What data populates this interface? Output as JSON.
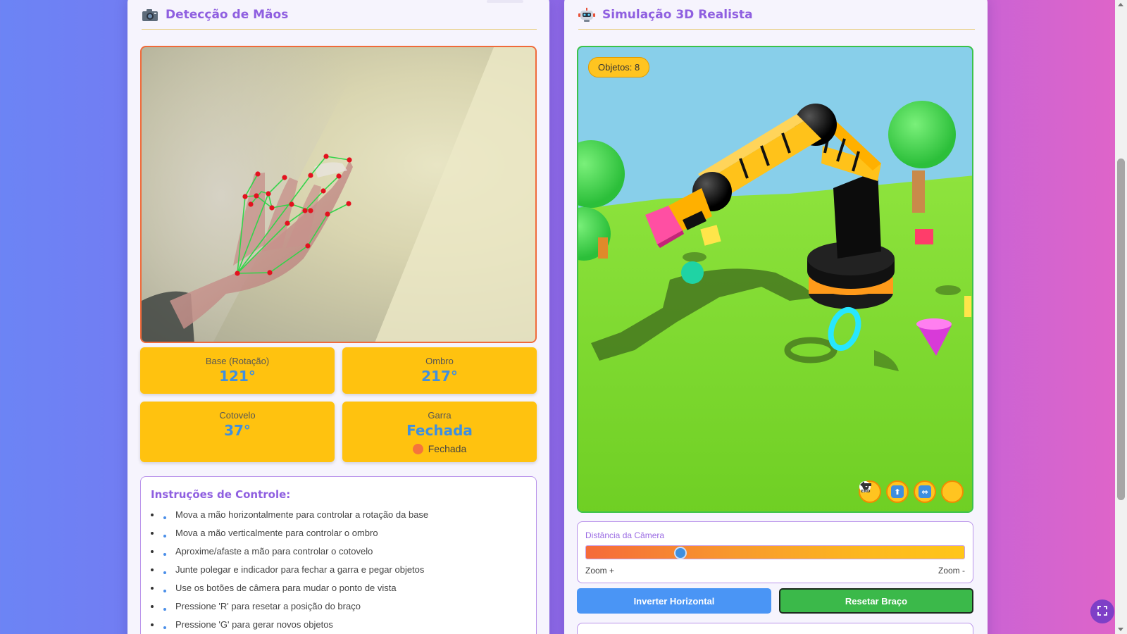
{
  "hand_panel": {
    "title": "Detecção de Mãos",
    "icon": "camera-icon"
  },
  "angles": {
    "base": {
      "label": "Base (Rotação)",
      "value": "121°"
    },
    "shoulder": {
      "label": "Ombro",
      "value": "217°"
    },
    "elbow": {
      "label": "Cotovelo",
      "value": "37°"
    },
    "grip": {
      "label": "Garra",
      "value": "Fechada",
      "state": "Fechada",
      "state_color": "#f5743c"
    }
  },
  "instructions": {
    "title": "Instruções de Controle:",
    "items": [
      "Mova a mão horizontalmente para controlar a rotação da base",
      "Mova a mão verticalmente para controlar o ombro",
      "Aproxime/afaste a mão para controlar o cotovelo",
      "Junte polegar e indicador para fechar a garra e pegar objetos",
      "Use os botões de câmera para mudar o ponto de vista",
      "Pressione 'R' para resetar a posição do braço",
      "Pressione 'G' para gerar novos objetos"
    ]
  },
  "sim_panel": {
    "title": "Simulação 3D Realista",
    "icon": "robot-icon",
    "objects_badge": "Objetos: 8",
    "camera_buttons": [
      "eye-icon",
      "arrow-up-icon",
      "arrows-horizontal-icon",
      "arrow-left-end-icon"
    ]
  },
  "zoom": {
    "label": "Distância da Câmera",
    "min_label": "Zoom +",
    "max_label": "Zoom -",
    "value": 0.25
  },
  "buttons": {
    "flip": "Inverter Horizontal",
    "reset": "Resetar Braço"
  },
  "colors": {
    "accent": "#8f5fe0",
    "card": "#ffc20f",
    "value_blue": "#3e8fe0",
    "reset_green": "#3bb94a",
    "flip_blue": "#4a95f5"
  }
}
